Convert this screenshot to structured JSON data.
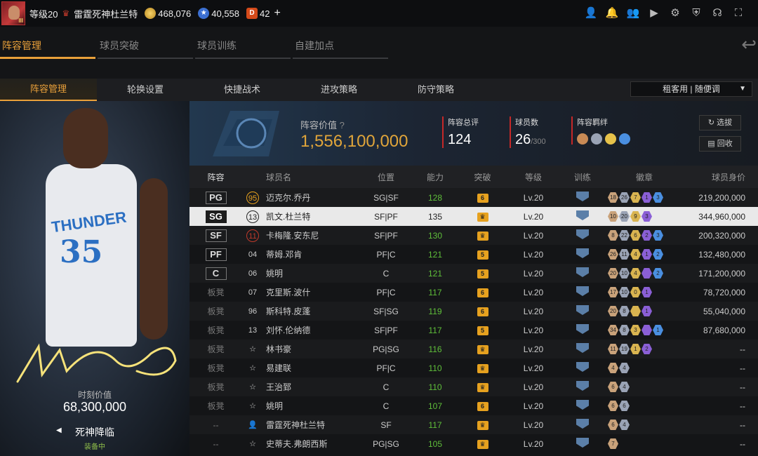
{
  "topbar": {
    "level": "等级20",
    "team_name": "雷霆死神杜兰特",
    "coins": "468,076",
    "stars": "40,558",
    "diamonds": "42",
    "plus": "+",
    "icons": [
      "user-icon",
      "bell-icon",
      "friends-icon",
      "video-icon",
      "gear-icon",
      "shield-icon",
      "headset-icon",
      "fullscreen-icon"
    ]
  },
  "tabs_main": [
    "阵容管理",
    "球员突破",
    "球员训练",
    "自建加点"
  ],
  "tabs_sub": [
    "阵容管理",
    "轮换设置",
    "快捷战术",
    "进攻策略",
    "防守策略"
  ],
  "rent_select": "租客用 | 随便调",
  "left_panel": {
    "moment_label": "时刻价值",
    "moment_value": "68,300,000",
    "skill_name": "死神降临",
    "skill_status": "装备中"
  },
  "summary": {
    "worth_label": "阵容价值",
    "worth_value": "1,556,100,000",
    "rating_label": "阵容总评",
    "rating_value": "124",
    "count_label": "球员数",
    "count_value": "26",
    "count_max": "/300",
    "bond_label": "阵容羁绊",
    "select_btn": "选拔",
    "recycle_btn": "回收"
  },
  "columns": [
    "阵容",
    "球员名",
    "位置",
    "能力",
    "突破",
    "等级",
    "训练",
    "徽章",
    "球员身价"
  ],
  "players": [
    {
      "slot": "PG",
      "starter": true,
      "num": "95",
      "num_color": "#e6a11f",
      "name": "迈克尔.乔丹",
      "role": "SG|SF",
      "ability": "128",
      "ab_color": "#5fbf3a",
      "brk": "6",
      "lv": "Lv.20",
      "badges": [
        "18",
        "26",
        "7",
        "1",
        "3"
      ],
      "value": "219,200,000"
    },
    {
      "slot": "SG",
      "starter": true,
      "num": "13",
      "num_color": "#222",
      "name": "凯文.杜兰特",
      "role": "SF|PF",
      "ability": "135",
      "ab_color": "#222",
      "brk": "",
      "lv": "Lv.20",
      "badges": [
        "10",
        "20",
        "9",
        "3"
      ],
      "value": "344,960,000",
      "selected": true
    },
    {
      "slot": "SF",
      "starter": true,
      "num": "11",
      "num_color": "#c0392b",
      "name": "卡梅隆.安东尼",
      "role": "SF|PF",
      "ability": "130",
      "ab_color": "#5fbf3a",
      "brk": "",
      "lv": "Lv.20",
      "badges": [
        "8",
        "22",
        "6",
        "2",
        "3"
      ],
      "value": "200,320,000"
    },
    {
      "slot": "PF",
      "starter": true,
      "num": "04",
      "num_color": "",
      "name": "蒂姆.邓肯",
      "role": "PF|C",
      "ability": "121",
      "ab_color": "#5fbf3a",
      "brk": "5",
      "lv": "Lv.20",
      "badges": [
        "26",
        "11",
        "4",
        "1",
        "2"
      ],
      "value": "132,480,000"
    },
    {
      "slot": "C",
      "starter": true,
      "num": "06",
      "num_color": "",
      "name": "姚明",
      "role": "C",
      "ability": "121",
      "ab_color": "#5fbf3a",
      "brk": "5",
      "lv": "Lv.20",
      "badges": [
        "20",
        "10",
        "4",
        "",
        "2"
      ],
      "value": "171,200,000"
    },
    {
      "slot": "板凳",
      "starter": false,
      "num": "07",
      "num_color": "",
      "name": "克里斯.波什",
      "role": "PF|C",
      "ability": "117",
      "ab_color": "#5fbf3a",
      "brk": "6",
      "lv": "Lv.20",
      "badges": [
        "17",
        "10",
        "0",
        "1"
      ],
      "value": "78,720,000"
    },
    {
      "slot": "板凳",
      "starter": false,
      "num": "96",
      "num_color": "",
      "name": "斯科特.皮蓬",
      "role": "SF|SG",
      "ability": "119",
      "ab_color": "#5fbf3a",
      "brk": "6",
      "lv": "Lv.20",
      "badges": [
        "20",
        "8",
        "",
        "1"
      ],
      "value": "55,040,000"
    },
    {
      "slot": "板凳",
      "starter": false,
      "num": "13",
      "num_color": "",
      "name": "刘怀.伦纳德",
      "role": "SF|PF",
      "ability": "117",
      "ab_color": "#5fbf3a",
      "brk": "5",
      "lv": "Lv.20",
      "badges": [
        "34",
        "8",
        "3",
        "",
        "1"
      ],
      "value": "87,680,000"
    },
    {
      "slot": "板凳",
      "starter": false,
      "num": "☆",
      "num_color": "",
      "name": "林书豪",
      "role": "PG|SG",
      "ability": "116",
      "ab_color": "#5fbf3a",
      "brk": "",
      "lv": "Lv.20",
      "badges": [
        "11",
        "19",
        "1",
        "2"
      ],
      "value": "--"
    },
    {
      "slot": "板凳",
      "starter": false,
      "num": "☆",
      "num_color": "",
      "name": "易建联",
      "role": "PF|C",
      "ability": "110",
      "ab_color": "#5fbf3a",
      "brk": "",
      "lv": "Lv.20",
      "badges": [
        "4",
        "4"
      ],
      "value": "--"
    },
    {
      "slot": "板凳",
      "starter": false,
      "num": "☆",
      "num_color": "",
      "name": "王治郅",
      "role": "C",
      "ability": "110",
      "ab_color": "#5fbf3a",
      "brk": "",
      "lv": "Lv.20",
      "badges": [
        "6",
        "4"
      ],
      "value": "--"
    },
    {
      "slot": "板凳",
      "starter": false,
      "num": "☆",
      "num_color": "",
      "name": "姚明",
      "role": "C",
      "ability": "107",
      "ab_color": "#5fbf3a",
      "brk": "6",
      "lv": "Lv.20",
      "badges": [
        "6",
        "6"
      ],
      "value": "--"
    },
    {
      "slot": "--",
      "starter": false,
      "num": "👤",
      "num_color": "",
      "name": "雷霆死神杜兰特",
      "role": "SF",
      "ability": "117",
      "ab_color": "#5fbf3a",
      "brk": "",
      "lv": "Lv.20",
      "badges": [
        "6",
        "4"
      ],
      "value": "--"
    },
    {
      "slot": "--",
      "starter": false,
      "num": "☆",
      "num_color": "",
      "name": "史蒂夫.弗朗西斯",
      "role": "PG|SG",
      "ability": "105",
      "ab_color": "#5fbf3a",
      "brk": "",
      "lv": "Lv.20",
      "badges": [
        "7"
      ],
      "value": "--"
    }
  ],
  "colors": {
    "accent": "#e9a03a",
    "ability_green": "#5fbf3a",
    "break_gold": "#e6a11f"
  }
}
